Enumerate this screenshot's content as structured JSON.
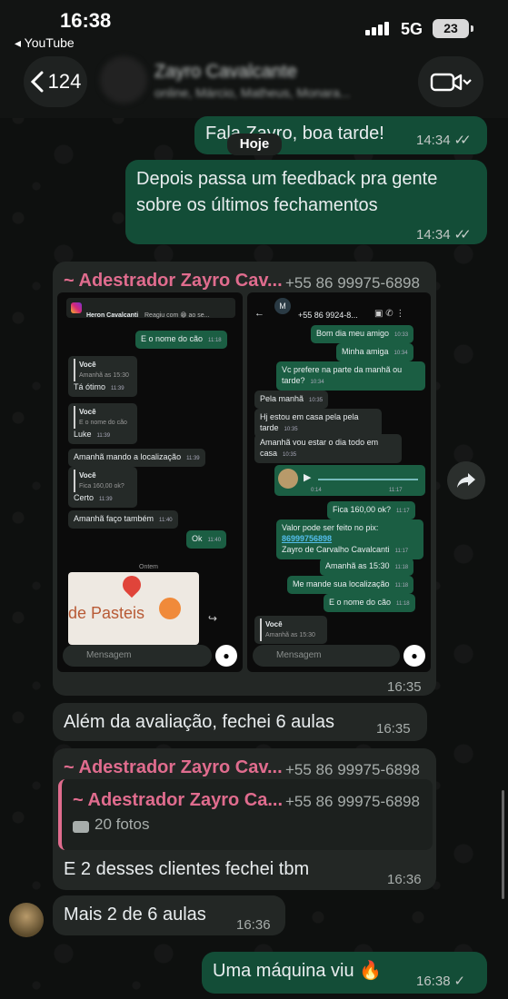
{
  "status": {
    "time": "16:38",
    "back_app": "YouTube",
    "network": "5G",
    "battery": "23"
  },
  "header": {
    "back_count": "124",
    "contact_name": "Zayro Cavalcante",
    "contact_sub": "online, Márcio, Matheus, Monara..."
  },
  "chat": {
    "day_label": "Hoje",
    "msg1": {
      "text": "Fala Zayro, boa tarde!",
      "time": "14:34"
    },
    "msg2": {
      "line1": "Depois passa um feedback pra gente",
      "line2": "sobre os últimos fechamentos",
      "time": "14:34"
    },
    "msg3": {
      "sender": "~ Adestrador Zayro Cav...",
      "phone": "+55 86 99975-6898",
      "time": "16:35",
      "left_shot": {
        "top_name": "Heron Cavalcanti",
        "top_reaction": "Reagiu com 😁 ao se...",
        "bubbles": [
          {
            "text": "E o nome do cão",
            "time": "11:18"
          },
          {
            "quote_author": "Você",
            "quote_text": "Amanhã as 15:30",
            "text": "Tá ótimo",
            "time": "11:39"
          },
          {
            "quote_author": "Você",
            "quote_text": "E o nome do cão",
            "text": "Luke",
            "time": "11:39"
          },
          {
            "text": "Amanhã mando a localização",
            "time": "11:39"
          },
          {
            "quote_author": "Você",
            "quote_text": "Fica 160,00 ok?",
            "text": "Certo",
            "time": "11:39"
          },
          {
            "text": "Amanhã faço também",
            "time": "11:40"
          },
          {
            "text": "Ok",
            "time": "11:40"
          }
        ],
        "day": "Ontem",
        "map_text": "de Pasteis",
        "composer": "Mensagem"
      },
      "right_shot": {
        "top_letter": "M",
        "top_phone": "+55 86 9924-8...",
        "bubbles": [
          {
            "text": "Bom dia meu amigo",
            "time": "10:33"
          },
          {
            "text": "Minha amiga",
            "time": "10:34"
          },
          {
            "text": "Vc prefere na parte da manhã ou tarde?",
            "time": "10:34"
          },
          {
            "text": "Pela manhã",
            "time": "10:35"
          },
          {
            "text": "Hj estou em casa pela pela tarde",
            "time": "10:35"
          },
          {
            "text": "Amanhã vou estar o dia todo em casa",
            "time": "10:35"
          },
          {
            "audio_duration": "0:14",
            "time": "11:17"
          },
          {
            "text": "Fica 160,00 ok?",
            "time": "11:17"
          },
          {
            "line1": "Valor pode ser feito no pix:",
            "link": "86999756898",
            "line3": "Zayro de Carvalho Cavalcanti",
            "time": "11:17"
          },
          {
            "text": "Amanhã as 15:30",
            "time": "11:18"
          },
          {
            "text": "Me mande sua localização",
            "time": "11:18"
          },
          {
            "text": "E o nome do cão",
            "time": "11:18"
          },
          {
            "quote_author": "Você",
            "quote_text": "Amanhã as 15:30"
          }
        ],
        "composer": "Mensagem"
      }
    },
    "msg4": {
      "text": "Além da avaliação, fechei 6 aulas",
      "time": "16:35"
    },
    "msg5": {
      "sender": "~ Adestrador Zayro Cav...",
      "phone": "+55 86 99975-6898",
      "quote_sender": "~ Adestrador Zayro Ca...",
      "quote_phone": "+55 86 99975-6898",
      "quote_text": "20 fotos",
      "text": "E 2 desses clientes fechei tbm",
      "time": "16:36"
    },
    "msg6": {
      "text": "Mais 2 de 6 aulas",
      "time": "16:36"
    },
    "msg7": {
      "text": "Uma máquina viu 🔥",
      "time": "16:38"
    }
  },
  "colors": {
    "outgoing": "#134d37",
    "incoming": "#232725",
    "sender_name": "#e06c8e",
    "link": "#53bdeb"
  }
}
